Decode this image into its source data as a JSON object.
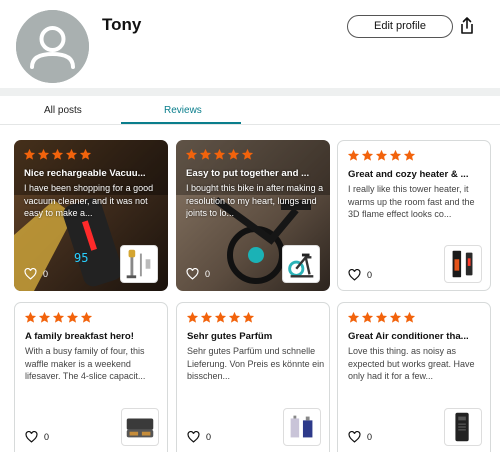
{
  "profile": {
    "name": "Tony",
    "edit_label": "Edit profile",
    "avatar_icon": "person-placeholder-icon",
    "share_icon": "share-icon"
  },
  "tabs": [
    {
      "label": "All posts",
      "active": false
    },
    {
      "label": "Reviews",
      "active": true
    }
  ],
  "accent": "#0a7e8c",
  "star_color": "#f2630c",
  "reviews": [
    {
      "stars": 5,
      "title": "Nice rechargeable Vacuu...",
      "body": "I have been shopping for a good vacuum cleaner, and it was not easy to make a...",
      "likes": "0",
      "product": "stick vacuum"
    },
    {
      "stars": 5,
      "title": "Easy to put together and ...",
      "body": "I bought this bike in after making a resolution to my heart, lungs and joints to lo...",
      "likes": "0",
      "product": "exercise bike"
    },
    {
      "stars": 5,
      "title": "Great and cozy heater & ...",
      "body": "I really like this tower heater, it warms up the room fast and the 3D flame effect looks co...",
      "likes": "0",
      "product": "tower heater"
    },
    {
      "stars": 5,
      "title": "A family breakfast hero!",
      "body": "With a busy family of four, this waffle maker is a weekend lifesaver. The 4-slice capacit...",
      "likes": "0",
      "product": "waffle maker"
    },
    {
      "stars": 5,
      "title": "Sehr gutes Parfüm",
      "body": "Sehr gutes Parfüm und schnelle Lieferung. Von Preis es könnte ein bisschen...",
      "likes": "0",
      "product": "perfume"
    },
    {
      "stars": 5,
      "title": "Great Air conditioner tha...",
      "body": "Love this thing. as noisy as expected but works great. Have only had it for a few...",
      "likes": "0",
      "product": "portable air conditioner"
    }
  ]
}
